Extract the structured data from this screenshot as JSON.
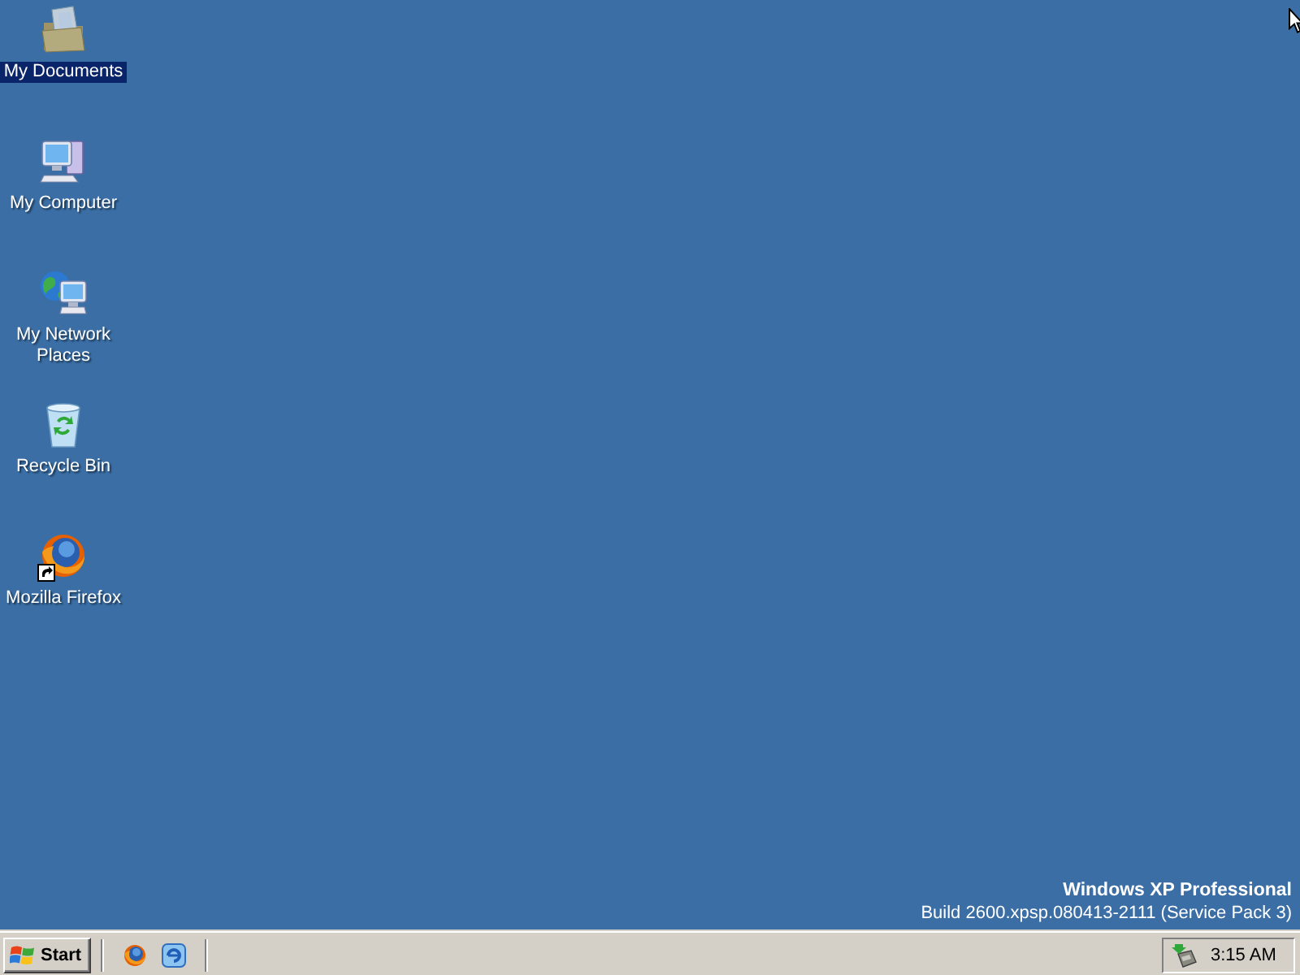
{
  "desktop_icons": [
    {
      "label": "My Documents",
      "kind": "documents",
      "selected": true,
      "shortcut": false
    },
    {
      "label": "My Computer",
      "kind": "computer",
      "selected": false,
      "shortcut": false
    },
    {
      "label": "My Network Places",
      "kind": "network",
      "selected": false,
      "shortcut": false
    },
    {
      "label": "Recycle Bin",
      "kind": "recycle_bin",
      "selected": false,
      "shortcut": false
    },
    {
      "label": "Mozilla Firefox",
      "kind": "firefox",
      "selected": false,
      "shortcut": true
    }
  ],
  "version_info": {
    "edition": "Windows XP Professional",
    "build": "Build 2600.xpsp.080413-2111 (Service Pack 3)"
  },
  "taskbar": {
    "start_button": "Start",
    "quick_launch": [
      {
        "kind": "firefox"
      },
      {
        "kind": "swirl"
      }
    ],
    "clock": "3:15 AM"
  }
}
